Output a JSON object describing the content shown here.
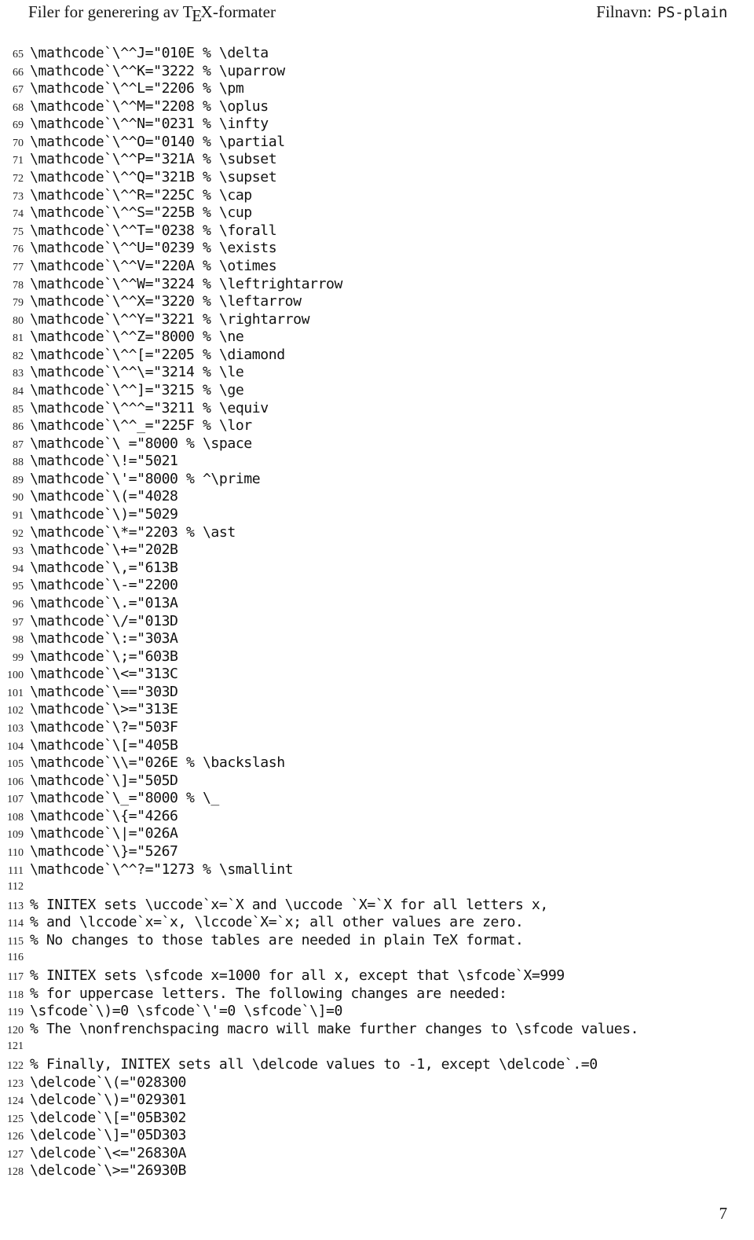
{
  "header": {
    "left_prefix": "Filer for generering av T",
    "left_tex_e": "e",
    "left_tex_x": "X",
    "left_suffix": "-formater",
    "left_full": "Filer for generering av TeX-formater",
    "filename_label": "Filnavn:",
    "filename_value": "PS-plain"
  },
  "folio": {
    "page_number": "7"
  },
  "listing": {
    "first_line_number": 65,
    "last_line_number": 128,
    "lines": [
      {
        "no": "65",
        "code": "\\mathcode`\\^^J=\"010E % \\delta"
      },
      {
        "no": "66",
        "code": "\\mathcode`\\^^K=\"3222 % \\uparrow"
      },
      {
        "no": "67",
        "code": "\\mathcode`\\^^L=\"2206 % \\pm"
      },
      {
        "no": "68",
        "code": "\\mathcode`\\^^M=\"2208 % \\oplus"
      },
      {
        "no": "69",
        "code": "\\mathcode`\\^^N=\"0231 % \\infty"
      },
      {
        "no": "70",
        "code": "\\mathcode`\\^^O=\"0140 % \\partial"
      },
      {
        "no": "71",
        "code": "\\mathcode`\\^^P=\"321A % \\subset"
      },
      {
        "no": "72",
        "code": "\\mathcode`\\^^Q=\"321B % \\supset"
      },
      {
        "no": "73",
        "code": "\\mathcode`\\^^R=\"225C % \\cap"
      },
      {
        "no": "74",
        "code": "\\mathcode`\\^^S=\"225B % \\cup"
      },
      {
        "no": "75",
        "code": "\\mathcode`\\^^T=\"0238 % \\forall"
      },
      {
        "no": "76",
        "code": "\\mathcode`\\^^U=\"0239 % \\exists"
      },
      {
        "no": "77",
        "code": "\\mathcode`\\^^V=\"220A % \\otimes"
      },
      {
        "no": "78",
        "code": "\\mathcode`\\^^W=\"3224 % \\leftrightarrow"
      },
      {
        "no": "79",
        "code": "\\mathcode`\\^^X=\"3220 % \\leftarrow"
      },
      {
        "no": "80",
        "code": "\\mathcode`\\^^Y=\"3221 % \\rightarrow"
      },
      {
        "no": "81",
        "code": "\\mathcode`\\^^Z=\"8000 % \\ne"
      },
      {
        "no": "82",
        "code": "\\mathcode`\\^^[=\"2205 % \\diamond"
      },
      {
        "no": "83",
        "code": "\\mathcode`\\^^\\=\"3214 % \\le"
      },
      {
        "no": "84",
        "code": "\\mathcode`\\^^]=\"3215 % \\ge"
      },
      {
        "no": "85",
        "code": "\\mathcode`\\^^^=\"3211 % \\equiv"
      },
      {
        "no": "86",
        "code": "\\mathcode`\\^^_=\"225F % \\lor"
      },
      {
        "no": "87",
        "code": "\\mathcode`\\ =\"8000 % \\space"
      },
      {
        "no": "88",
        "code": "\\mathcode`\\!=\"5021"
      },
      {
        "no": "89",
        "code": "\\mathcode`\\'=\"8000 % ^\\prime"
      },
      {
        "no": "90",
        "code": "\\mathcode`\\(=\"4028"
      },
      {
        "no": "91",
        "code": "\\mathcode`\\)=\"5029"
      },
      {
        "no": "92",
        "code": "\\mathcode`\\*=\"2203 % \\ast"
      },
      {
        "no": "93",
        "code": "\\mathcode`\\+=\"202B"
      },
      {
        "no": "94",
        "code": "\\mathcode`\\,=\"613B"
      },
      {
        "no": "95",
        "code": "\\mathcode`\\-=\"2200"
      },
      {
        "no": "96",
        "code": "\\mathcode`\\.=\"013A"
      },
      {
        "no": "97",
        "code": "\\mathcode`\\/=\"013D"
      },
      {
        "no": "98",
        "code": "\\mathcode`\\:=\"303A"
      },
      {
        "no": "99",
        "code": "\\mathcode`\\;=\"603B"
      },
      {
        "no": "100",
        "code": "\\mathcode`\\<=\"313C"
      },
      {
        "no": "101",
        "code": "\\mathcode`\\==\"303D"
      },
      {
        "no": "102",
        "code": "\\mathcode`\\>=\"313E"
      },
      {
        "no": "103",
        "code": "\\mathcode`\\?=\"503F"
      },
      {
        "no": "104",
        "code": "\\mathcode`\\[=\"405B"
      },
      {
        "no": "105",
        "code": "\\mathcode`\\\\=\"026E % \\backslash"
      },
      {
        "no": "106",
        "code": "\\mathcode`\\]=\"505D"
      },
      {
        "no": "107",
        "code": "\\mathcode`\\_=\"8000 % \\_"
      },
      {
        "no": "108",
        "code": "\\mathcode`\\{=\"4266"
      },
      {
        "no": "109",
        "code": "\\mathcode`\\|=\"026A"
      },
      {
        "no": "110",
        "code": "\\mathcode`\\}=\"5267"
      },
      {
        "no": "111",
        "code": "\\mathcode`\\^^?=\"1273 % \\smallint"
      },
      {
        "no": "112",
        "code": ""
      },
      {
        "no": "113",
        "code": "% INITEX sets \\uccode`x=`X and \\uccode `X=`X for all letters x,"
      },
      {
        "no": "114",
        "code": "% and \\lccode`x=`x, \\lccode`X=`x; all other values are zero."
      },
      {
        "no": "115",
        "code": "% No changes to those tables are needed in plain TeX format."
      },
      {
        "no": "116",
        "code": ""
      },
      {
        "no": "117",
        "code": "% INITEX sets \\sfcode x=1000 for all x, except that \\sfcode`X=999"
      },
      {
        "no": "118",
        "code": "% for uppercase letters. The following changes are needed:"
      },
      {
        "no": "119",
        "code": "\\sfcode`\\)=0 \\sfcode`\\'=0 \\sfcode`\\]=0"
      },
      {
        "no": "120",
        "code": "% The \\nonfrenchspacing macro will make further changes to \\sfcode values."
      },
      {
        "no": "121",
        "code": ""
      },
      {
        "no": "122",
        "code": "% Finally, INITEX sets all \\delcode values to -1, except \\delcode`.=0"
      },
      {
        "no": "123",
        "code": "\\delcode`\\(=\"028300"
      },
      {
        "no": "124",
        "code": "\\delcode`\\)=\"029301"
      },
      {
        "no": "125",
        "code": "\\delcode`\\[=\"05B302"
      },
      {
        "no": "126",
        "code": "\\delcode`\\]=\"05D303"
      },
      {
        "no": "127",
        "code": "\\delcode`\\<=\"26830A"
      },
      {
        "no": "128",
        "code": "\\delcode`\\>=\"26930B"
      }
    ]
  },
  "colors": {
    "page_background": "#ffffff",
    "text": "#111111",
    "line_number": "#222222"
  }
}
